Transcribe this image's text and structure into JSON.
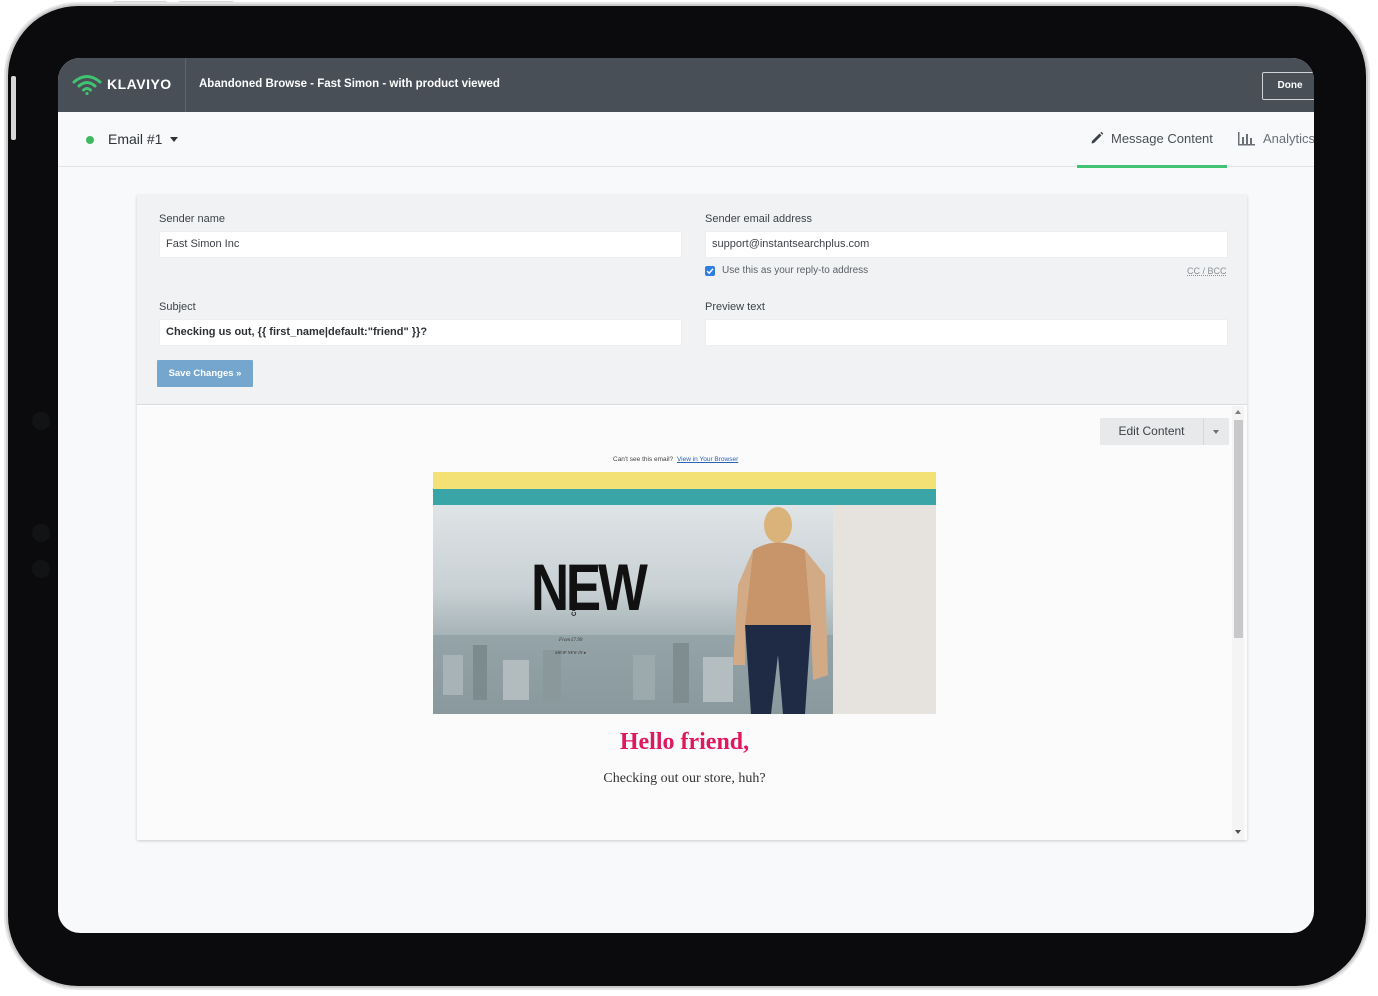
{
  "app": {
    "logo_text": "KLAVIYO",
    "flow_title": "Abandoned Browse - Fast Simon - with product viewed",
    "done_label": "Done"
  },
  "subheader": {
    "email_label": "Email #1",
    "tabs": [
      {
        "label": "Message Content",
        "active": true,
        "icon": "pencil-icon"
      },
      {
        "label": "Analytics",
        "active": false,
        "icon": "bar-chart-icon"
      }
    ]
  },
  "form": {
    "sender_name_label": "Sender name",
    "sender_name_value": "Fast Simon Inc",
    "sender_email_label": "Sender email address",
    "sender_email_value": "support@instantsearchplus.com",
    "reply_to_label": "Use this as your reply-to address",
    "reply_to_checked": true,
    "cc_bcc_label": "CC / BCC",
    "subject_label": "Subject",
    "subject_value": "Checking us out, {{ first_name|default:\"friend\" }}?",
    "preview_text_label": "Preview text",
    "preview_text_value": "",
    "save_label": "Save Changes »"
  },
  "preview": {
    "edit_label": "Edit Content",
    "cant_see_text": "Can't see this email?",
    "view_browser_link": "View in Your Browser",
    "hero_headline": "NEW",
    "hero_collection": "COLLECTION",
    "hero_from": "From £7.99",
    "hero_shop": "SHOP NEW IN ▸",
    "greeting": "Hello friend,",
    "body_text": "Checking out our store, huh?"
  },
  "colors": {
    "topbar": "#494f57",
    "accent_green": "#41c471",
    "save_button": "#74a6ce",
    "greeting": "#e0195f",
    "stripe_yellow": "#f3e176",
    "stripe_teal": "#3aa5a7"
  }
}
